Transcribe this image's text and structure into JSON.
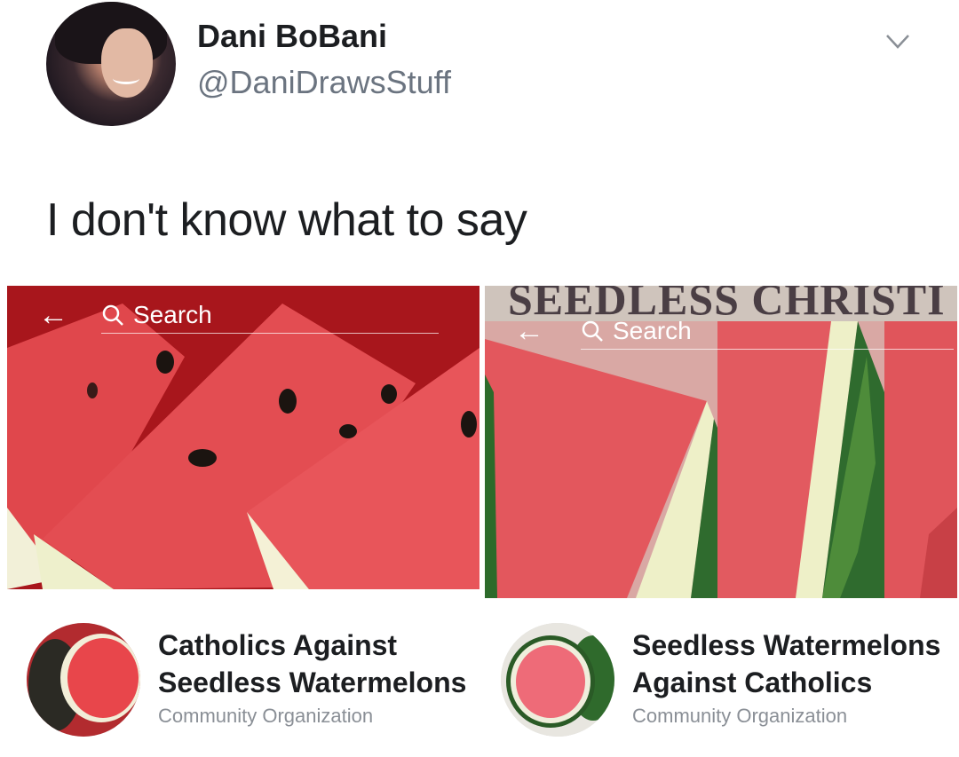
{
  "tweet": {
    "author_name": "Dani BoBani",
    "author_handle": "@DaniDrawsStuff",
    "text": "I don't know what to say",
    "menu_icon": "chevron-down-icon"
  },
  "screenshots": [
    {
      "search_placeholder": "Search",
      "header_caption": "",
      "page_name": "Catholics Against Seedless Watermelons",
      "page_category": "Community Organization"
    },
    {
      "search_placeholder": "Search",
      "header_caption": "SEEDLESS CHRISTI",
      "page_name": "Seedless Watermelons Against Catholics",
      "page_category": "Community Organization"
    }
  ],
  "colors": {
    "watermelon_red": "#d93a3e",
    "rind_green": "#2f6b2e",
    "handle_gray": "#6b7480"
  }
}
